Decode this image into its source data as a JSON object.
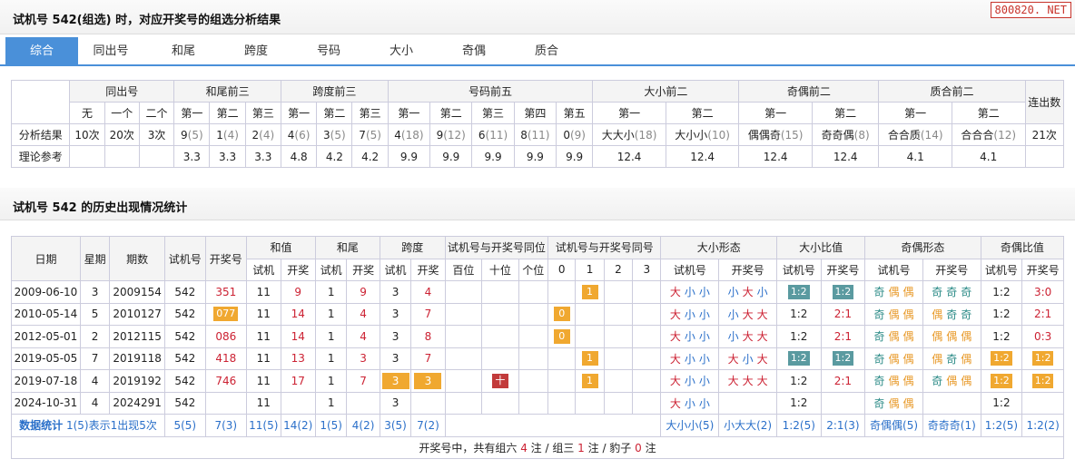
{
  "brand": "800820. NET",
  "title1": "试机号 542(组选) 时，对应开奖号的组选分析结果",
  "title2": "试机号 542 的历史出现情况统计",
  "tabs": [
    "综合",
    "同出号",
    "和尾",
    "跨度",
    "号码",
    "大小",
    "奇偶",
    "质合"
  ],
  "t1": {
    "groups": [
      "同出号",
      "和尾前三",
      "跨度前三",
      "号码前五",
      "大小前二",
      "奇偶前二",
      "质合前二",
      "连出数"
    ],
    "sub": [
      "无",
      "一个",
      "二个",
      "第一",
      "第二",
      "第三",
      "第一",
      "第二",
      "第三",
      "第一",
      "第二",
      "第三",
      "第四",
      "第五",
      "第一",
      "第二",
      "第一",
      "第二",
      "第一",
      "第二"
    ],
    "row1_label": "分析结果",
    "row1": [
      [
        "10次",
        ""
      ],
      [
        "20次",
        ""
      ],
      [
        "3次",
        ""
      ],
      [
        "9",
        "(5)"
      ],
      [
        "1",
        "(4)"
      ],
      [
        "2",
        "(4)"
      ],
      [
        "4",
        "(6)"
      ],
      [
        "3",
        "(5)"
      ],
      [
        "7",
        "(5)"
      ],
      [
        "4",
        "(18)"
      ],
      [
        "9",
        "(12)"
      ],
      [
        "6",
        "(11)"
      ],
      [
        "8",
        "(11)"
      ],
      [
        "0",
        "(9)"
      ],
      [
        "大大小",
        "(18)"
      ],
      [
        "大小小",
        "(10)"
      ],
      [
        "偶偶奇",
        "(15)"
      ],
      [
        "奇奇偶",
        "(8)"
      ],
      [
        "合合质",
        "(14)"
      ],
      [
        "合合合",
        "(12)"
      ],
      [
        "21次",
        ""
      ]
    ],
    "row2_label": "理论参考",
    "row2": [
      "",
      "",
      "",
      "3.3",
      "3.3",
      "3.3",
      "4.8",
      "4.2",
      "4.2",
      "9.9",
      "9.9",
      "9.9",
      "9.9",
      "9.9",
      "12.4",
      "12.4",
      "12.4",
      "12.4",
      "4.1",
      "4.1",
      ""
    ]
  },
  "t2": {
    "h1": [
      "日期",
      "星期",
      "期数",
      "试机号",
      "开奖号",
      "和值",
      "和尾",
      "跨度",
      "试机号与开奖号同位",
      "试机号与开奖号同号",
      "大小形态",
      "大小比值",
      "奇偶形态",
      "奇偶比值"
    ],
    "h2": [
      "试机",
      "开奖",
      "试机",
      "开奖",
      "试机",
      "开奖",
      "百位",
      "十位",
      "个位",
      "0",
      "1",
      "2",
      "3",
      "试机号",
      "开奖号",
      "试机号",
      "开奖号",
      "试机号",
      "开奖号",
      "试机号",
      "开奖号"
    ],
    "rows": [
      {
        "date": "2009-06-10",
        "wk": "3",
        "issue": "2009154",
        "sj": "542",
        "kj": "351",
        "kjbox": false,
        "hz1": "11",
        "hz2": "9",
        "hw1": "1",
        "hw2": "9",
        "kd1": "3",
        "kd2": "4",
        "kdbox": false,
        "tw": "",
        "th": [
          "",
          "1",
          "",
          ""
        ],
        "dx1": [
          "大",
          "小",
          "小"
        ],
        "dx2": [
          "小",
          "大",
          "小"
        ],
        "dxb1": "1:2",
        "dxb2": "1:2",
        "dxbox": true,
        "jo1": [
          "奇",
          "偶",
          "偶"
        ],
        "jo2": [
          "奇",
          "奇",
          "奇"
        ],
        "job1": "1:2",
        "job2": "3:0",
        "jobox": false
      },
      {
        "date": "2010-05-14",
        "wk": "5",
        "issue": "2010127",
        "sj": "542",
        "kj": "077",
        "kjbox": true,
        "hz1": "11",
        "hz2": "14",
        "hw1": "1",
        "hw2": "4",
        "kd1": "3",
        "kd2": "7",
        "kdbox": false,
        "tw": "",
        "th": [
          "0",
          "",
          "",
          ""
        ],
        "dx1": [
          "大",
          "小",
          "小"
        ],
        "dx2": [
          "小",
          "大",
          "大"
        ],
        "dxb1": "1:2",
        "dxb2": "2:1",
        "dxbox": false,
        "jo1": [
          "奇",
          "偶",
          "偶"
        ],
        "jo2": [
          "偶",
          "奇",
          "奇"
        ],
        "job1": "1:2",
        "job2": "2:1",
        "jobox": false
      },
      {
        "date": "2012-05-01",
        "wk": "2",
        "issue": "2012115",
        "sj": "542",
        "kj": "086",
        "kjbox": false,
        "hz1": "11",
        "hz2": "14",
        "hw1": "1",
        "hw2": "4",
        "kd1": "3",
        "kd2": "8",
        "kdbox": false,
        "tw": "",
        "th": [
          "0",
          "",
          "",
          ""
        ],
        "dx1": [
          "大",
          "小",
          "小"
        ],
        "dx2": [
          "小",
          "大",
          "大"
        ],
        "dxb1": "1:2",
        "dxb2": "2:1",
        "dxbox": false,
        "jo1": [
          "奇",
          "偶",
          "偶"
        ],
        "jo2": [
          "偶",
          "偶",
          "偶"
        ],
        "job1": "1:2",
        "job2": "0:3",
        "jobox": false
      },
      {
        "date": "2019-05-05",
        "wk": "7",
        "issue": "2019118",
        "sj": "542",
        "kj": "418",
        "kjbox": false,
        "hz1": "11",
        "hz2": "13",
        "hw1": "1",
        "hw2": "3",
        "kd1": "3",
        "kd2": "7",
        "kdbox": false,
        "tw": "",
        "th": [
          "",
          "1",
          "",
          ""
        ],
        "dx1": [
          "大",
          "小",
          "小"
        ],
        "dx2": [
          "大",
          "小",
          "大"
        ],
        "dxb1": "1:2",
        "dxb2": "1:2",
        "dxbox": true,
        "jo1": [
          "奇",
          "偶",
          "偶"
        ],
        "jo2": [
          "偶",
          "奇",
          "偶"
        ],
        "job1": "1:2",
        "job2": "1:2",
        "jobox": true
      },
      {
        "date": "2019-07-18",
        "wk": "4",
        "issue": "2019192",
        "sj": "542",
        "kj": "746",
        "kjbox": false,
        "hz1": "11",
        "hz2": "17",
        "hw1": "1",
        "hw2": "7",
        "kd1": "3",
        "kd2": "3",
        "kdbox": true,
        "tw": "十",
        "th": [
          "",
          "1",
          "",
          ""
        ],
        "dx1": [
          "大",
          "小",
          "小"
        ],
        "dx2": [
          "大",
          "大",
          "大"
        ],
        "dxb1": "1:2",
        "dxb2": "2:1",
        "dxbox": false,
        "jo1": [
          "奇",
          "偶",
          "偶"
        ],
        "jo2": [
          "奇",
          "偶",
          "偶"
        ],
        "job1": "1:2",
        "job2": "1:2",
        "jobox": true
      },
      {
        "date": "2024-10-31",
        "wk": "4",
        "issue": "2024291",
        "sj": "542",
        "kj": "",
        "kjbox": false,
        "hz1": "11",
        "hz2": "",
        "hw1": "1",
        "hw2": "",
        "kd1": "3",
        "kd2": "",
        "kdbox": false,
        "tw": "",
        "th": [
          "",
          "",
          "",
          ""
        ],
        "dx1": [
          "大",
          "小",
          "小"
        ],
        "dx2": [
          "",
          "",
          ""
        ],
        "dxb1": "1:2",
        "dxb2": "",
        "dxbox": false,
        "jo1": [
          "奇",
          "偶",
          "偶"
        ],
        "jo2": [
          "",
          "",
          ""
        ],
        "job1": "1:2",
        "job2": "",
        "jobox": false
      }
    ],
    "sum": {
      "label": "数据统计",
      "desc": "1(5)表示1出现5次",
      "sj": "5(5)",
      "kj": "7(3)",
      "hz1": "11(5)",
      "hz2": "14(2)",
      "hw1": "1(5)",
      "hw2": "4(2)",
      "kd1": "3(5)",
      "kd2": "7(2)",
      "dx1": "大小小(5)",
      "dx2": "小大大(2)",
      "dxb1": "1:2(5)",
      "dxb2": "2:1(3)",
      "jo1": "奇偶偶(5)",
      "jo2": "奇奇奇(1)",
      "job1": "1:2(5)",
      "job2": "1:2(2)"
    },
    "footer": {
      "p1": "开奖号中，共有组六 ",
      "n1": "4",
      "p2": " 注 / 组三 ",
      "n2": "1",
      "p3": " 注 / 豹子 ",
      "n3": "0",
      "p4": " 注"
    }
  }
}
